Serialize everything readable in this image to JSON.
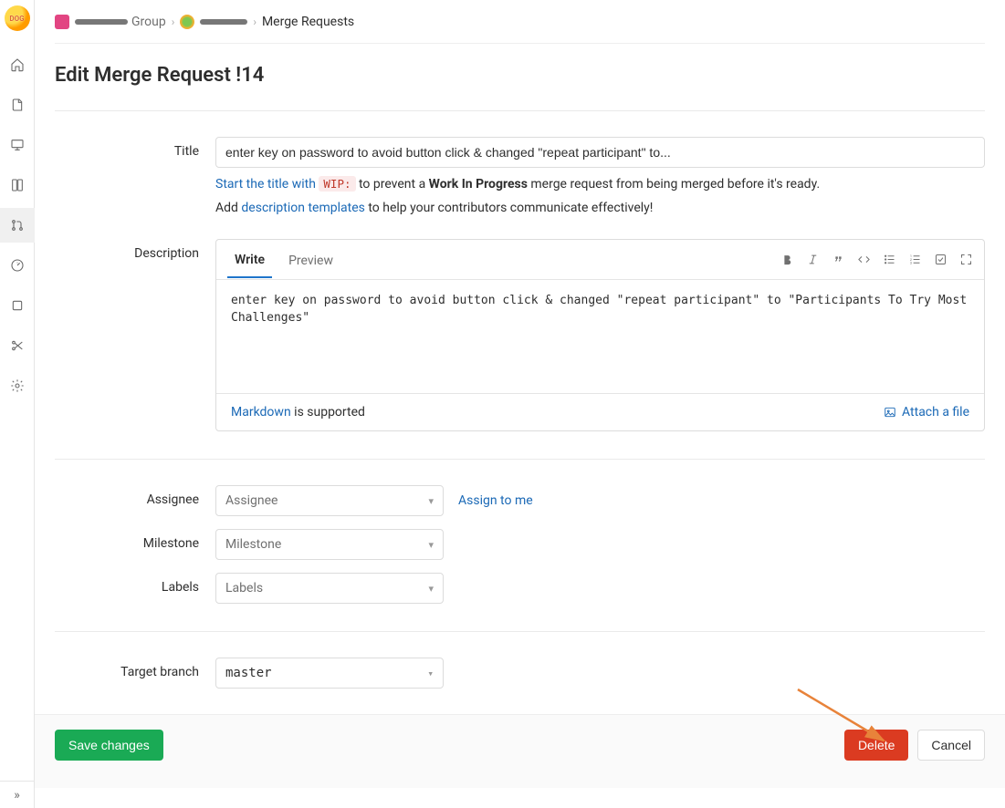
{
  "breadcrumbs": {
    "group_label": "Group",
    "current": "Merge Requests"
  },
  "page_title": "Edit Merge Request !14",
  "title": {
    "label": "Title",
    "value": "enter key on password to avoid button click & changed \"repeat participant\" to..."
  },
  "wip_help": {
    "prefix": "Start the title with ",
    "code": "WIP:",
    "mid": " to prevent a ",
    "bold": "Work In Progress",
    "suffix": " merge request from being merged before it's ready."
  },
  "template_help": {
    "prefix": "Add ",
    "link": "description templates",
    "suffix": " to help your contributors communicate effectively!"
  },
  "description": {
    "label": "Description",
    "tabs": {
      "write": "Write",
      "preview": "Preview"
    },
    "value": "enter key on password to avoid button click & changed \"repeat participant\" to \"Participants To Try Most Challenges\"",
    "markdown_link": "Markdown",
    "markdown_supported": " is supported",
    "attach": "Attach a file"
  },
  "assignee": {
    "label": "Assignee",
    "placeholder": "Assignee",
    "assign_to_me": "Assign to me"
  },
  "milestone": {
    "label": "Milestone",
    "placeholder": "Milestone"
  },
  "labels": {
    "label": "Labels",
    "placeholder": "Labels"
  },
  "target_branch": {
    "label": "Target branch",
    "value": "master"
  },
  "actions": {
    "save": "Save changes",
    "delete": "Delete",
    "cancel": "Cancel"
  },
  "colors": {
    "link": "#1b69b6",
    "success": "#1aaa55",
    "danger": "#db3b21",
    "arrow": "#e8833a"
  }
}
